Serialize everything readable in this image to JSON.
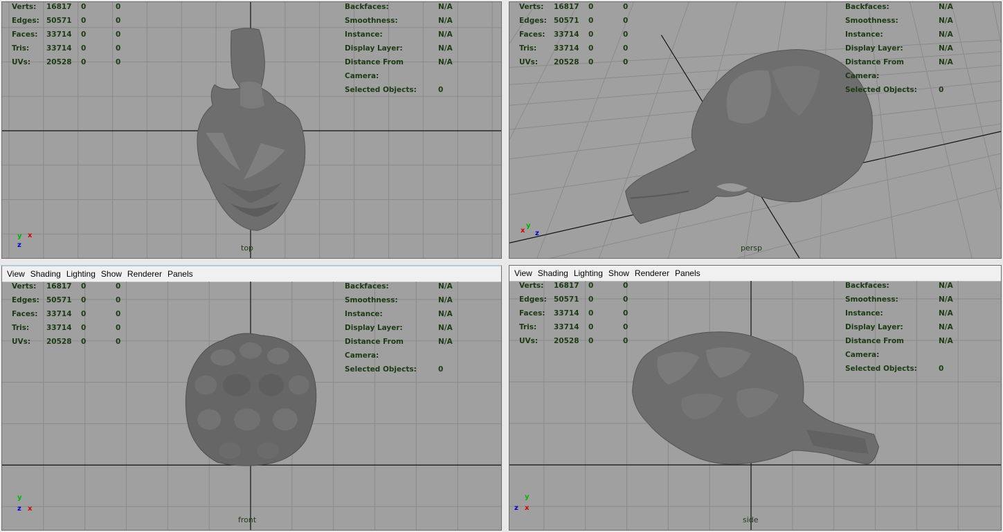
{
  "menu": [
    "View",
    "Shading",
    "Lighting",
    "Show",
    "Renderer",
    "Panels"
  ],
  "hud_stats": [
    {
      "label": "Verts:",
      "v1": "16817",
      "v2": "0",
      "v3": "0"
    },
    {
      "label": "Edges:",
      "v1": "50571",
      "v2": "0",
      "v3": "0"
    },
    {
      "label": "Faces:",
      "v1": "33714",
      "v2": "0",
      "v3": "0"
    },
    {
      "label": "Tris:",
      "v1": "33714",
      "v2": "0",
      "v3": "0"
    },
    {
      "label": "UVs:",
      "v1": "20528",
      "v2": "0",
      "v3": "0"
    }
  ],
  "hud_info": [
    {
      "label": "Backfaces:",
      "value": "N/A"
    },
    {
      "label": "Smoothness:",
      "value": "N/A"
    },
    {
      "label": "Instance:",
      "value": "N/A"
    },
    {
      "label": "Display Layer:",
      "value": "N/A"
    },
    {
      "label": "Distance From Camera:",
      "value": "N/A"
    },
    {
      "label": "Selected Objects:",
      "value": "0"
    }
  ],
  "viewports": {
    "top": {
      "camera": "top",
      "axis_a": "y",
      "axis_b": "x",
      "axis_c": "z"
    },
    "persp": {
      "camera": "persp",
      "axis_a": "y",
      "axis_b": "x",
      "axis_c": "z"
    },
    "front": {
      "camera": "front",
      "axis_a": "y",
      "axis_b": "z",
      "axis_c": "x"
    },
    "side": {
      "camera": "side",
      "axis_a": "y",
      "axis_b": "z",
      "axis_c": "x"
    }
  },
  "colors": {
    "viewport_bg": "#a0a0a0",
    "grid": "#8a8a8a",
    "grid_axis": "#111111",
    "hud_text": "#1b3b13",
    "mesh": "#6e6e6e",
    "axis_x": "#d40000",
    "axis_y": "#00b400",
    "axis_z": "#0000d0"
  }
}
